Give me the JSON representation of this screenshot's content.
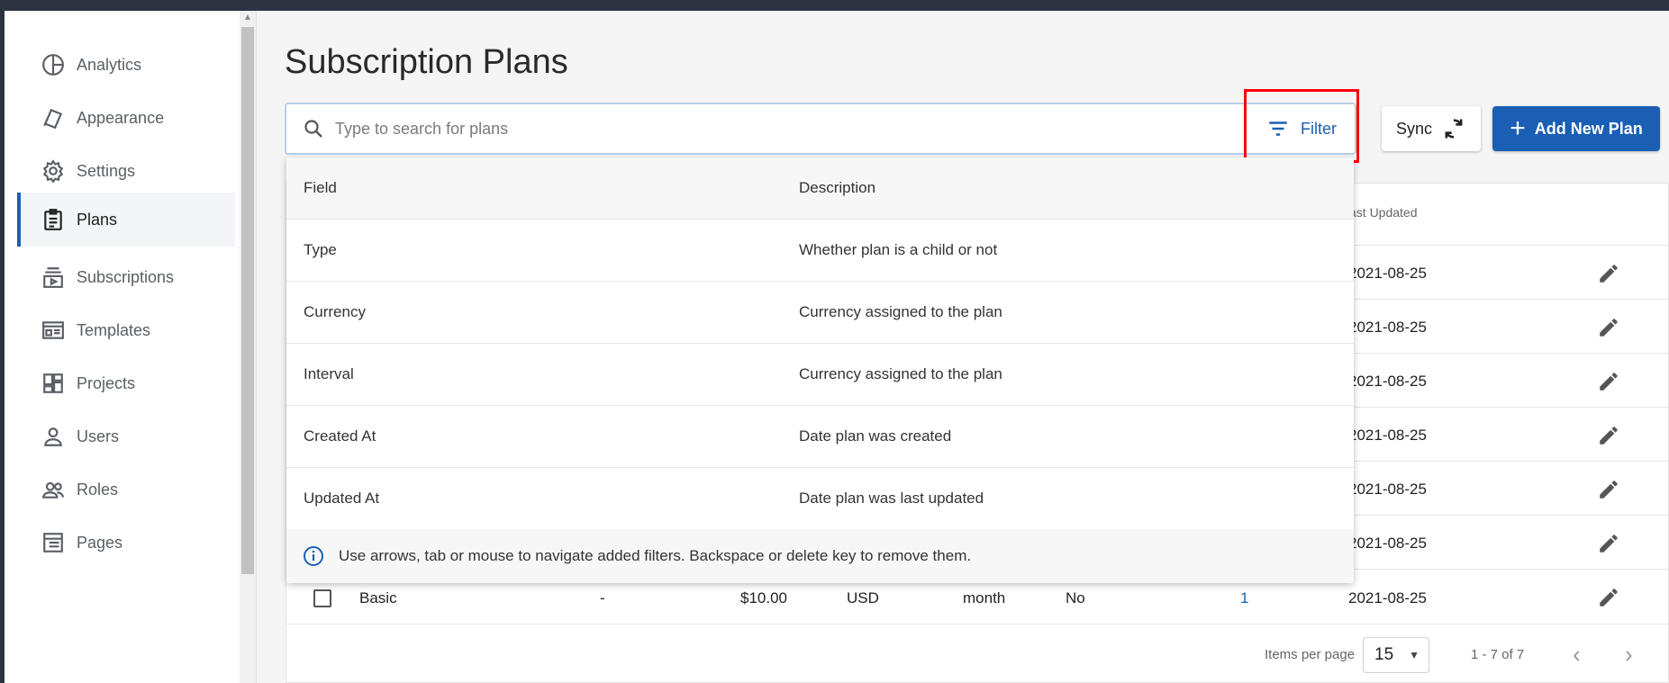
{
  "sidebar": {
    "items": [
      {
        "label": "Analytics",
        "icon": "analytics-icon"
      },
      {
        "label": "Appearance",
        "icon": "appearance-icon"
      },
      {
        "label": "Settings",
        "icon": "gear-icon"
      },
      {
        "label": "Plans",
        "icon": "clipboard-icon",
        "active": true
      },
      {
        "label": "Subscriptions",
        "icon": "subscriptions-icon"
      },
      {
        "label": "Templates",
        "icon": "template-icon"
      },
      {
        "label": "Projects",
        "icon": "dashboard-icon"
      },
      {
        "label": "Users",
        "icon": "person-icon"
      },
      {
        "label": "Roles",
        "icon": "people-icon"
      },
      {
        "label": "Pages",
        "icon": "pages-icon"
      }
    ]
  },
  "page": {
    "title": "Subscription Plans"
  },
  "search": {
    "placeholder": "Type to search for plans",
    "value": ""
  },
  "toolbar": {
    "filter_label": "Filter",
    "sync_label": "Sync",
    "add_label": "Add New Plan"
  },
  "filter_menu": {
    "headers": {
      "field": "Field",
      "description": "Description"
    },
    "rows": [
      {
        "field": "Type",
        "description": "Whether plan is a child or not"
      },
      {
        "field": "Currency",
        "description": "Currency assigned to the plan"
      },
      {
        "field": "Interval",
        "description": "Currency assigned to the plan"
      },
      {
        "field": "Created At",
        "description": "Date plan was created"
      },
      {
        "field": "Updated At",
        "description": "Date plan was last updated"
      }
    ],
    "info": "Use arrows, tab or mouse to navigate added filters. Backspace or delete key to remove them."
  },
  "table": {
    "last_updated_header": "ast Updated",
    "dates": [
      "2021-08-25",
      "2021-08-25",
      "2021-08-25",
      "2021-08-25",
      "2021-08-25",
      "2021-08-25"
    ],
    "basic_row": {
      "name": "Basic",
      "parent": "-",
      "price": "$10.00",
      "currency": "USD",
      "interval": "month",
      "child": "No",
      "count": "1",
      "date": "2021-08-25"
    }
  },
  "pagination": {
    "items_per_page_label": "Items per page",
    "items_per_page": "15",
    "range": "1 - 7 of 7",
    "prev": "‹",
    "next": "›"
  },
  "colors": {
    "accent": "#1a5fb4",
    "highlight": "#ff0000",
    "topbar": "#2d3441"
  }
}
